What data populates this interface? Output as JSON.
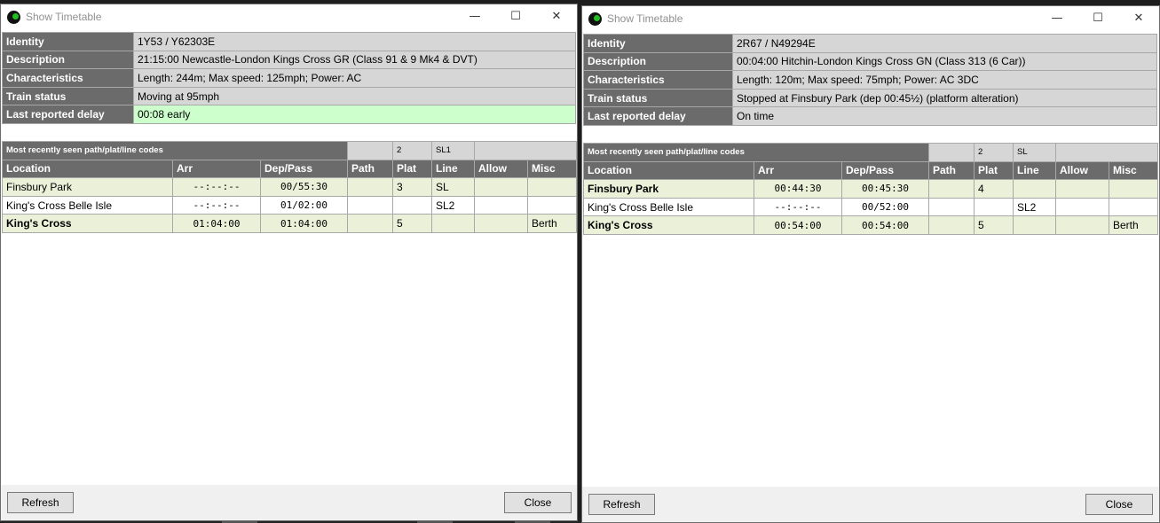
{
  "windows": [
    {
      "title": "Show Timetable",
      "info": [
        {
          "label": "Identity",
          "value": "1Y53 / Y62303E"
        },
        {
          "label": "Description",
          "value": "21:15:00 Newcastle-London Kings Cross GR (Class 91 & 9 Mk4 & DVT)"
        },
        {
          "label": "Characteristics",
          "value": "Length: 244m; Max speed: 125mph; Power: AC"
        },
        {
          "label": "Train status",
          "value": "Moving at 95mph"
        },
        {
          "label": "Last reported delay",
          "value": "00:08 early"
        }
      ],
      "codes": {
        "label": "Most recently seen path/plat/line codes",
        "path": "",
        "plat": "2",
        "line": "SL1",
        "allow": ""
      },
      "columns": [
        "Location",
        "Arr",
        "Dep/Pass",
        "Path",
        "Plat",
        "Line",
        "Allow",
        "Misc"
      ],
      "rows": [
        {
          "location": "Finsbury Park",
          "arr": "--:--:--",
          "dep": "00/55:30",
          "path": "",
          "plat": "3",
          "line": "SL",
          "allow": "",
          "misc": ""
        },
        {
          "location": "King's Cross Belle Isle",
          "arr": "--:--:--",
          "dep": "01/02:00",
          "path": "",
          "plat": "",
          "line": "SL2",
          "allow": "",
          "misc": ""
        },
        {
          "location": "King's Cross",
          "arr": "01:04:00",
          "dep": "01:04:00",
          "path": "",
          "plat": "5",
          "line": "",
          "allow": "",
          "misc": "Berth"
        }
      ],
      "buttons": {
        "refresh": "Refresh",
        "close": "Close"
      }
    },
    {
      "title": "Show Timetable",
      "info": [
        {
          "label": "Identity",
          "value": "2R67 / N49294E"
        },
        {
          "label": "Description",
          "value": "00:04:00 Hitchin-London Kings Cross GN (Class 313 (6 Car))"
        },
        {
          "label": "Characteristics",
          "value": "Length: 120m; Max speed: 75mph; Power: AC 3DC"
        },
        {
          "label": "Train status",
          "value": "Stopped at Finsbury Park (dep 00:45½) (platform alteration)"
        },
        {
          "label": "Last reported delay",
          "value": "On time"
        }
      ],
      "codes": {
        "label": "Most recently seen path/plat/line codes",
        "path": "",
        "plat": "2",
        "line": "SL",
        "allow": ""
      },
      "columns": [
        "Location",
        "Arr",
        "Dep/Pass",
        "Path",
        "Plat",
        "Line",
        "Allow",
        "Misc"
      ],
      "rows": [
        {
          "location": "Finsbury Park",
          "arr": "00:44:30",
          "dep": "00:45:30",
          "path": "",
          "plat": "4",
          "line": "",
          "allow": "",
          "misc": ""
        },
        {
          "location": "King's Cross Belle Isle",
          "arr": "--:--:--",
          "dep": "00/52:00",
          "path": "",
          "plat": "",
          "line": "SL2",
          "allow": "",
          "misc": ""
        },
        {
          "location": "King's Cross",
          "arr": "00:54:00",
          "dep": "00:54:00",
          "path": "",
          "plat": "5",
          "line": "",
          "allow": "",
          "misc": "Berth"
        }
      ],
      "buttons": {
        "refresh": "Refresh",
        "close": "Close"
      }
    }
  ],
  "colors": {
    "label_bg": "#6b6b6b",
    "value_bg": "#d6d6d6",
    "early_bg": "#ccffcc",
    "stop_row_bg": "#ebf0d9"
  },
  "icons": {
    "app": "train-app-icon",
    "minimize": "minimize-icon",
    "maximize": "maximize-icon",
    "close": "close-icon"
  }
}
